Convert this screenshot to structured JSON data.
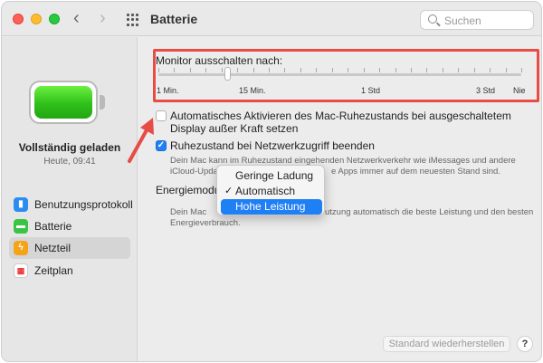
{
  "window": {
    "title": "Batterie"
  },
  "search": {
    "placeholder": "Suchen"
  },
  "sidebar": {
    "status": "Vollständig geladen",
    "time": "Heute, 09:41",
    "items": [
      {
        "label": "Benutzungsprotokoll",
        "icon": "usage-chart-icon",
        "selected": false
      },
      {
        "label": "Batterie",
        "icon": "battery-icon",
        "selected": false
      },
      {
        "label": "Netzteil",
        "icon": "power-bolt-icon",
        "selected": true
      },
      {
        "label": "Zeitplan",
        "icon": "calendar-icon",
        "selected": false
      }
    ]
  },
  "display_off": {
    "label": "Monitor ausschalten nach:",
    "ticks": [
      "1 Min.",
      "15 Min.",
      "1 Std",
      "3 Std",
      "Nie"
    ],
    "value": "10 Min."
  },
  "options": {
    "auto_sleep": {
      "checked": false,
      "line1": "Automatisches Aktivieren des Mac-Ruhezustands bei ausgeschaltetem",
      "line2": "Display außer Kraft setzen"
    },
    "network_wake": {
      "checked": true,
      "label": "Ruhezustand bei Netzwerkzugriff beenden",
      "desc_line1": "Dein Mac kann im Ruhezustand eingehenden Netzwerkverkehr wie iMessages und andere",
      "desc_line2_left": "iCloud-Upda",
      "desc_line2_right": "e Apps immer auf dem neuesten Stand sind."
    }
  },
  "energy_mode": {
    "label": "Energiemodus",
    "menu": [
      {
        "label": "Geringe Ladung",
        "checked": false,
        "highlighted": false
      },
      {
        "label": "Automatisch",
        "checked": true,
        "highlighted": false
      },
      {
        "label": "Hohe Leistung",
        "checked": false,
        "highlighted": true
      }
    ],
    "desc_line1_left": "Dein Mac",
    "desc_line1_right": "utzung automatisch die beste Leistung und den besten",
    "desc_line2": "Energieverbrauch."
  },
  "footer": {
    "reset_label": "Standard wiederherstellen",
    "help_label": "?"
  },
  "colors": {
    "accent": "#1f7ff5",
    "annotation": "#e74c47",
    "battery_green": "#2fc01a"
  }
}
